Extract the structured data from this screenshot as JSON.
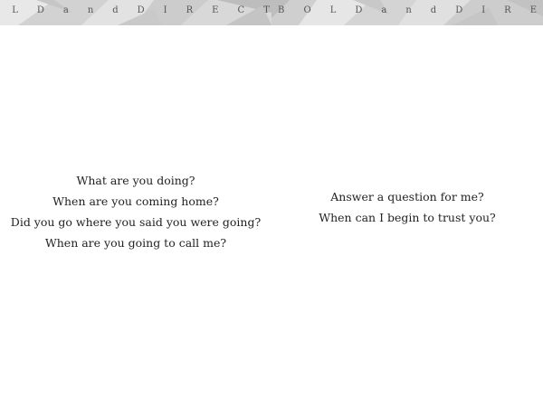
{
  "header": {
    "left_text": "OLDandDIRECT",
    "right_text": "BOLDandDIREC"
  },
  "left_page": {
    "lines": [
      "What are you doing?",
      "When are you coming home?",
      "Did you go where you said you were going?",
      "When are you going to call me?"
    ]
  },
  "right_page": {
    "lines": [
      "Answer a question for me?",
      "When can I begin to trust you?"
    ]
  },
  "colors": {
    "band_light": "#e4e4e4",
    "band_mid": "#cfcfcf",
    "band_dark": "#bdbdbd",
    "text": "#222222"
  }
}
